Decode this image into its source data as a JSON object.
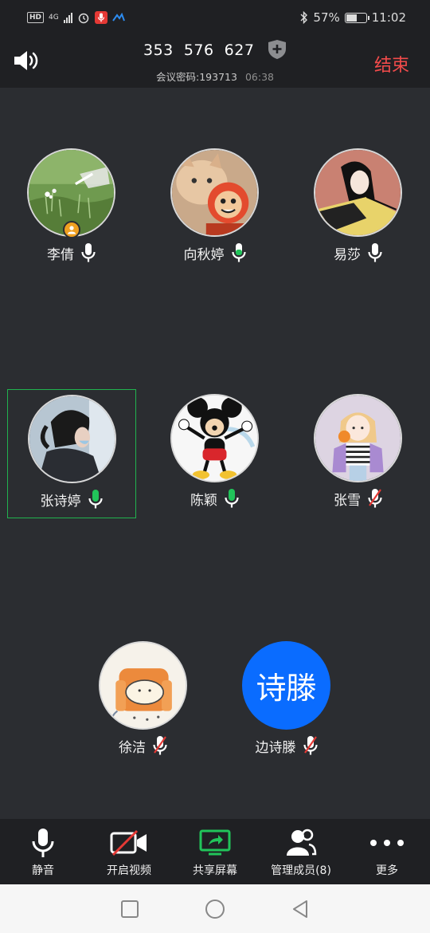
{
  "status_bar": {
    "hd": "HD",
    "network": "4G",
    "battery_percent": "57%",
    "battery_level": 0.57,
    "time": "11:02"
  },
  "header": {
    "meeting_id": "353  576  627",
    "password_label": "会议密码:193713",
    "timer": "06:38",
    "end_label": "结束"
  },
  "participants": [
    {
      "name": "李倩",
      "mic": "on",
      "host": true
    },
    {
      "name": "向秋婷",
      "mic": "speaking"
    },
    {
      "name": "易莎",
      "mic": "on"
    },
    {
      "name": "张诗婷",
      "mic": "speaking",
      "active": true
    },
    {
      "name": "陈颖",
      "mic": "speaking"
    },
    {
      "name": "张雪",
      "mic": "muted"
    },
    {
      "name": "徐洁",
      "mic": "muted"
    },
    {
      "name": "边诗滕",
      "mic": "muted",
      "avatar_text": "诗滕"
    }
  ],
  "toolbar": {
    "mute_label": "静音",
    "video_label": "开启视频",
    "share_label": "共享屏幕",
    "members_label": "管理成员(8)",
    "more_label": "更多"
  },
  "colors": {
    "background": "#2b2d31",
    "bar": "#1f2023",
    "end_red": "#f24b4b",
    "speaking_green": "#21c45a",
    "muted_red": "#e53935",
    "active_border": "#21b34f",
    "text_avatar_blue": "#0a6cff"
  },
  "icons": [
    "speaker-icon",
    "shield-plus-icon",
    "mic-icon",
    "video-off-icon",
    "share-screen-icon",
    "members-icon",
    "more-dots-icon",
    "back-icon",
    "home-icon",
    "recents-icon"
  ]
}
